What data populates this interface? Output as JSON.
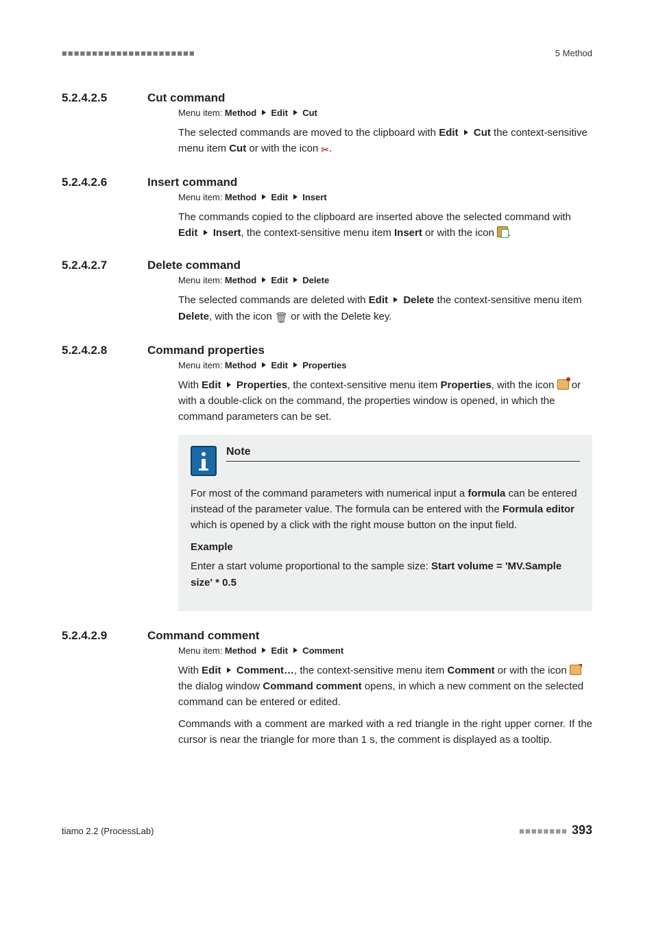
{
  "header": {
    "left_marks": "■■■■■■■■■■■■■■■■■■■■■■",
    "right": "5 Method"
  },
  "sections": [
    {
      "num": "5.2.4.2.5",
      "title": "Cut command",
      "menupath": [
        "Method",
        "Edit",
        "Cut"
      ],
      "para": {
        "pre": "The selected commands are moved to the clipboard with ",
        "b1": "Edit",
        "b2": "Cut",
        "mid": " the context-sensitive menu item ",
        "b3": "Cut",
        "mid2": " or with the icon ",
        "icon": "scissors-icon",
        "end": "."
      }
    },
    {
      "num": "5.2.4.2.6",
      "title": "Insert command",
      "menupath": [
        "Method",
        "Edit",
        "Insert"
      ],
      "para": {
        "pre": "The commands copied to the clipboard are inserted above the selected command with ",
        "b1": "Edit",
        "b2": "Insert",
        "mid": ", the context-sensitive menu item ",
        "b3": "Insert",
        "mid2": " or with the icon ",
        "icon": "paste-icon",
        "end": "."
      }
    },
    {
      "num": "5.2.4.2.7",
      "title": "Delete command",
      "menupath": [
        "Method",
        "Edit",
        "Delete"
      ],
      "para": {
        "pre": "The selected commands are deleted with ",
        "b1": "Edit",
        "b2": "Delete",
        "mid": " the context-sensitive menu item ",
        "b3": "Delete",
        "mid2": ", with the icon ",
        "icon": "trash-icon",
        "end": " or with the Delete key."
      }
    },
    {
      "num": "5.2.4.2.8",
      "title": "Command properties",
      "menupath": [
        "Method",
        "Edit",
        "Properties"
      ],
      "para": {
        "pre": "With ",
        "b1": "Edit",
        "b2": "Properties",
        "mid": ", the context-sensitive menu item ",
        "b3": "Properties",
        "mid2": ", with the icon ",
        "icon": "properties-icon",
        "end": " or with a double-click on the command, the properties window is opened, in which the command parameters can be set."
      },
      "note": {
        "title": "Note",
        "p1_pre": "For most of the command parameters with numerical input a ",
        "p1_b1": "formula",
        "p1_mid": " can be entered instead of the parameter value. The formula can be entered with the ",
        "p1_b2": "Formula editor",
        "p1_end": " which is opened by a click with the right mouse button on the input field.",
        "example_label": "Example",
        "ex_pre": "Enter a start volume proportional to the sample size: ",
        "ex_b": "Start volume = 'MV.Sample size' * 0.5"
      }
    },
    {
      "num": "5.2.4.2.9",
      "title": "Command comment",
      "menupath": [
        "Method",
        "Edit",
        "Comment"
      ],
      "para": {
        "pre": "With ",
        "b1": "Edit",
        "b2": "Comment…",
        "mid": ", the context-sensitive menu item ",
        "b3": "Comment",
        "mid2": " or with the icon ",
        "icon": "comment-icon",
        "end_pre": " the dialog window ",
        "end_b": "Command comment",
        "end": " opens, in which a new comment on the selected command can be entered or edited."
      },
      "para2": "Commands with a comment are marked with a red triangle in the right upper corner. If the cursor is near the triangle for more than 1 s, the comment is displayed as a tooltip."
    }
  ],
  "menuitem_label": "Menu item: ",
  "footer": {
    "left": "tiamo 2.2 (ProcessLab)",
    "dots": "■■■■■■■■",
    "page": "393"
  }
}
